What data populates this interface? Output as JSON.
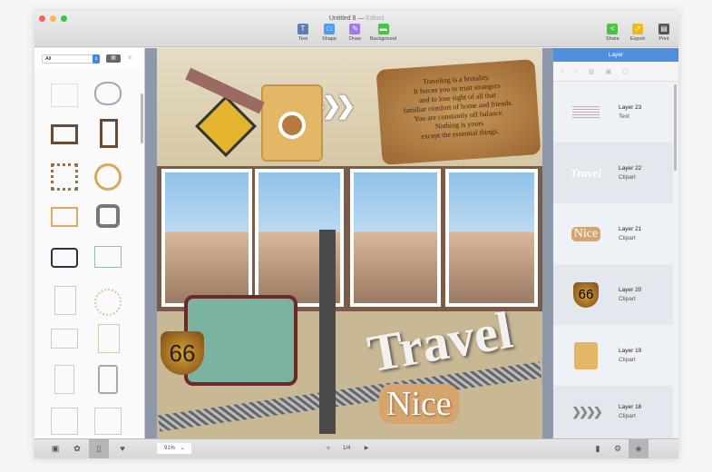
{
  "window": {
    "title": "Untitled 8",
    "status": "Edited"
  },
  "toolbar": {
    "items": [
      {
        "label": "Text",
        "color": "#5a7fb5"
      },
      {
        "label": "Shape",
        "color": "#4f9cf0"
      },
      {
        "label": "Draw",
        "color": "#a47ae8"
      },
      {
        "label": "Background",
        "color": "#47c24a"
      }
    ],
    "right": [
      {
        "label": "Share",
        "color": "#4cc341"
      },
      {
        "label": "Export",
        "color": "#f1b81b"
      },
      {
        "label": "Print",
        "color": "#555555"
      }
    ]
  },
  "left_panel": {
    "filter": "All"
  },
  "canvas": {
    "quote": [
      "Traveling is a brutality.",
      "It forces you to trust strangers",
      "and to lose sight of all that",
      "familiar comfort of home and friends.",
      "You are constantly off balance.",
      "Nothing is yours",
      "except the essential things."
    ],
    "travel": "Travel",
    "nice": "Nice",
    "route": "66"
  },
  "layers_panel": {
    "title": "Layer",
    "layers": [
      {
        "name": "Layer 23",
        "type": "Text"
      },
      {
        "name": "Layer 22",
        "type": "Clipart"
      },
      {
        "name": "Layer 21",
        "type": "Clipart"
      },
      {
        "name": "Layer 20",
        "type": "Clipart"
      },
      {
        "name": "Layer 19",
        "type": "Clipart"
      },
      {
        "name": "Layer 18",
        "type": "Clipart"
      }
    ]
  },
  "bottom": {
    "zoom": "91%",
    "page": "1/4"
  }
}
